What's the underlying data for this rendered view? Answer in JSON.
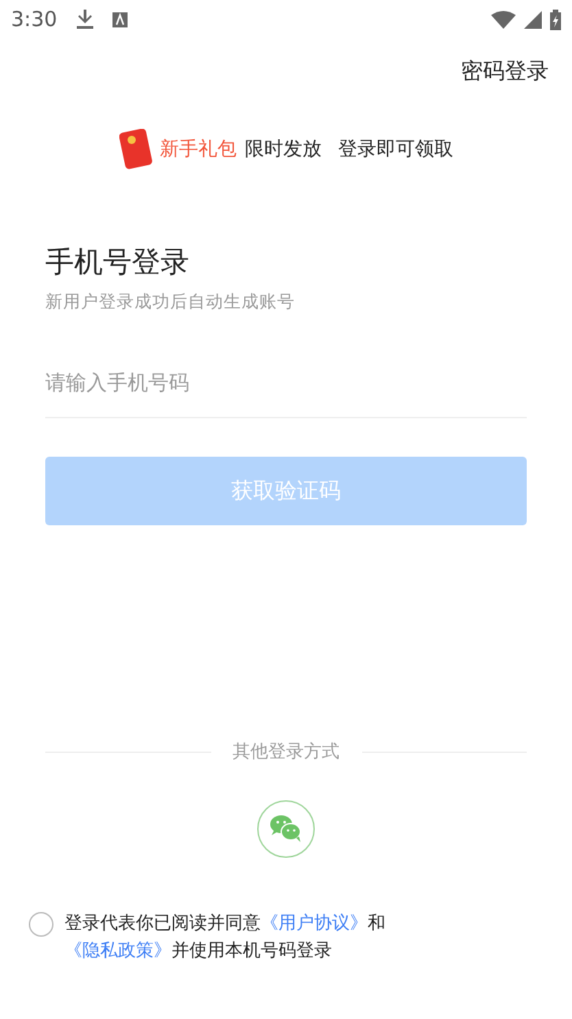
{
  "status_bar": {
    "time": "3:30"
  },
  "top_link": "密码登录",
  "promo": {
    "highlight": "新手礼包",
    "text_1": "限时发放",
    "text_2": "登录即可领取"
  },
  "title": "手机号登录",
  "subtitle": "新用户登录成功后自动生成账号",
  "phone_field": {
    "placeholder": "请输入手机号码"
  },
  "submit_button": {
    "label": "获取验证码",
    "disabled": true
  },
  "other_login": {
    "label": "其他登录方式"
  },
  "agreement": {
    "checked": false,
    "parts": [
      {
        "kind": "text",
        "text": "登录代表你已阅读并同意"
      },
      {
        "kind": "link",
        "text": "《用户协议》"
      },
      {
        "kind": "text",
        "text": "和"
      },
      {
        "kind": "link",
        "text": "《隐私政策》"
      },
      {
        "kind": "text",
        "text": "并使用本机号码登录"
      }
    ]
  }
}
